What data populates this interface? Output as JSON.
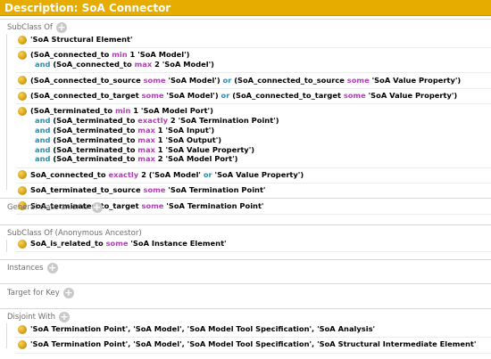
{
  "window": {
    "title": "Description: SoA Connector"
  },
  "sections": {
    "subclass_of": {
      "label": "SubClass Of",
      "entries": [
        {
          "lines": [
            [
              [
                "t",
                "'SoA Structural Element'"
              ]
            ]
          ]
        },
        {
          "lines": [
            [
              [
                "t",
                "(SoA_connected_to "
              ],
              [
                "k",
                "min"
              ],
              [
                "t",
                " 1 'SoA Model')"
              ]
            ],
            [
              [
                "b",
                "and"
              ],
              [
                "t",
                " (SoA_connected_to "
              ],
              [
                "k",
                "max"
              ],
              [
                "t",
                " 2 'SoA Model')"
              ]
            ]
          ]
        },
        {
          "lines": [
            [
              [
                "t",
                "(SoA_connected_to_source "
              ],
              [
                "k",
                "some"
              ],
              [
                "t",
                " 'SoA Model') "
              ],
              [
                "b",
                "or"
              ],
              [
                "t",
                " (SoA_connected_to_source "
              ],
              [
                "k",
                "some"
              ],
              [
                "t",
                " 'SoA Value Property')"
              ]
            ]
          ]
        },
        {
          "lines": [
            [
              [
                "t",
                "(SoA_connected_to_target "
              ],
              [
                "k",
                "some"
              ],
              [
                "t",
                " 'SoA Model') "
              ],
              [
                "b",
                "or"
              ],
              [
                "t",
                " (SoA_connected_to_target "
              ],
              [
                "k",
                "some"
              ],
              [
                "t",
                " 'SoA Value Property')"
              ]
            ]
          ]
        },
        {
          "lines": [
            [
              [
                "t",
                "(SoA_terminated_to "
              ],
              [
                "k",
                "min"
              ],
              [
                "t",
                " 1 'SoA Model Port')"
              ]
            ],
            [
              [
                "b",
                "and"
              ],
              [
                "t",
                " (SoA_terminated_to "
              ],
              [
                "k",
                "exactly"
              ],
              [
                "t",
                " 2 'SoA Termination Point')"
              ]
            ],
            [
              [
                "b",
                "and"
              ],
              [
                "t",
                " (SoA_terminated_to "
              ],
              [
                "k",
                "max"
              ],
              [
                "t",
                " 1 'SoA Input')"
              ]
            ],
            [
              [
                "b",
                "and"
              ],
              [
                "t",
                " (SoA_terminated_to "
              ],
              [
                "k",
                "max"
              ],
              [
                "t",
                " 1 'SoA Output')"
              ]
            ],
            [
              [
                "b",
                "and"
              ],
              [
                "t",
                " (SoA_terminated_to "
              ],
              [
                "k",
                "max"
              ],
              [
                "t",
                " 1 'SoA Value Property')"
              ]
            ],
            [
              [
                "b",
                "and"
              ],
              [
                "t",
                " (SoA_terminated_to "
              ],
              [
                "k",
                "max"
              ],
              [
                "t",
                " 2 'SoA Model Port')"
              ]
            ]
          ]
        },
        {
          "lines": [
            [
              [
                "t",
                "SoA_connected_to "
              ],
              [
                "k",
                "exactly"
              ],
              [
                "t",
                " 2 ('SoA Model' "
              ],
              [
                "b",
                "or"
              ],
              [
                "t",
                " 'SoA Value Property')"
              ]
            ]
          ]
        },
        {
          "lines": [
            [
              [
                "t",
                "SoA_terminated_to_source "
              ],
              [
                "k",
                "some"
              ],
              [
                "t",
                " 'SoA Termination Point'"
              ]
            ]
          ]
        },
        {
          "lines": [
            [
              [
                "t",
                "SoA_terminated_to_target "
              ],
              [
                "k",
                "some"
              ],
              [
                "t",
                " 'SoA Termination Point'"
              ]
            ]
          ]
        }
      ]
    },
    "general_class_axioms": {
      "label": "General class axioms"
    },
    "subclass_of_anonymous": {
      "label": "SubClass Of (Anonymous Ancestor)",
      "entries": [
        {
          "lines": [
            [
              [
                "t",
                "SoA_is_related_to "
              ],
              [
                "k",
                "some"
              ],
              [
                "t",
                " 'SoA Instance Element'"
              ]
            ]
          ]
        }
      ]
    },
    "instances": {
      "label": "Instances"
    },
    "target_for_key": {
      "label": "Target for Key"
    },
    "disjoint_with": {
      "label": "Disjoint With",
      "entries": [
        {
          "lines": [
            [
              [
                "t",
                "'SoA Termination Point', 'SoA Model', 'SoA Model Tool Specification', 'SoA Analysis'"
              ]
            ]
          ]
        },
        {
          "lines": [
            [
              [
                "t",
                "'SoA Termination Point', 'SoA Model', 'SoA Model Tool Specification', 'SoA Structural Intermediate Element'"
              ]
            ]
          ]
        }
      ]
    }
  },
  "icons": {
    "add": "add-circle-icon",
    "class": "class-bullet-icon"
  },
  "colors": {
    "title_bar": "#e6ac00",
    "keyword": "#b13fb5",
    "connective": "#2c8ab0",
    "bullet": "#d9a21a"
  }
}
